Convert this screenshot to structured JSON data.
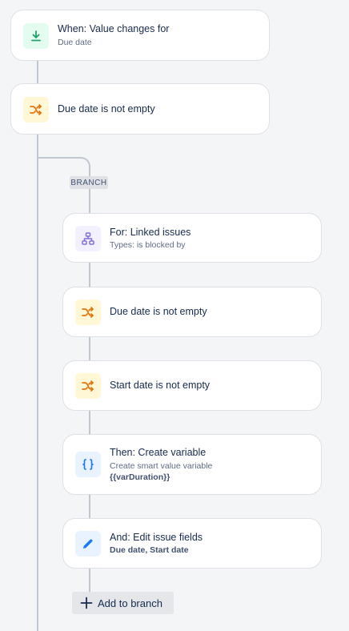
{
  "trigger": {
    "title": "When: Value changes for",
    "subtitle": "Due date",
    "icon": "download-icon",
    "color": "#22a06b"
  },
  "condition_1": {
    "title": "Due date is not empty",
    "icon": "shuffle-icon",
    "color": "#e2740c"
  },
  "branch": {
    "badge": "BRANCH",
    "items": [
      {
        "title": "For: Linked issues",
        "subtitle": "Types: is blocked by",
        "icon": "hierarchy-icon"
      },
      {
        "title": "Due date is not empty",
        "icon": "shuffle-icon"
      },
      {
        "title": "Start date is not empty",
        "icon": "shuffle-icon"
      },
      {
        "title": "Then: Create variable",
        "subtitle": "Create smart value variable",
        "detail": "{{varDuration}}",
        "icon": "braces-icon"
      },
      {
        "title": "And: Edit issue fields",
        "detail": "Due date, Start date",
        "icon": "pencil-icon"
      }
    ],
    "add_label": "Add to branch"
  },
  "colors": {
    "connector": "#c1c7d0",
    "branch_icon": "#8270db",
    "action_icon": "#1d7afc"
  }
}
